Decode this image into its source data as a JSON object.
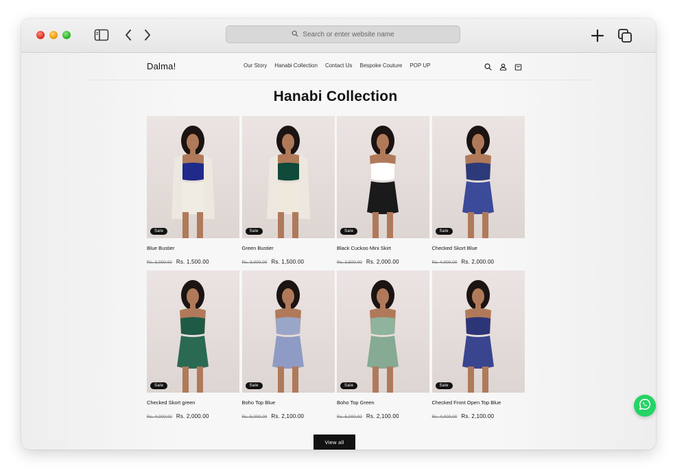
{
  "browser": {
    "address_placeholder": "Search or enter website name",
    "icons": [
      "sidebar-icon",
      "back-icon",
      "forward-icon",
      "plus-icon",
      "tabs-icon",
      "search-icon"
    ]
  },
  "header": {
    "brand": "Dalma!",
    "nav": [
      "Our Story",
      "Hanabi Collection",
      "Contact Us",
      "Bespoke Couture",
      "POP UP"
    ],
    "icons": [
      "search-icon",
      "account-icon",
      "cart-icon"
    ]
  },
  "collection": {
    "title": "Hanabi Collection",
    "badge": "Sale",
    "products": [
      {
        "name": "Blue Bustier",
        "old_price": "Rs. 3,000.00",
        "price": "Rs. 1,500.00",
        "top_color": "#1f2a8a",
        "bottom_color": "#f1ece3",
        "jacket": true
      },
      {
        "name": "Green Bustier",
        "old_price": "Rs. 3,000.00",
        "price": "Rs. 1,500.00",
        "top_color": "#0f4a3a",
        "bottom_color": "#efe8dc",
        "jacket": true
      },
      {
        "name": "Black Cuckoo Mini Skirt",
        "old_price": "Rs. 3,500.00",
        "price": "Rs. 2,000.00",
        "top_color": "#ffffff",
        "bottom_color": "#1a1a1a",
        "jacket": false
      },
      {
        "name": "Checked Skort Blue",
        "old_price": "Rs. 4,000.00",
        "price": "Rs. 2,000.00",
        "top_color": "#2d3a7a",
        "bottom_color": "#3c4a9a",
        "jacket": false
      },
      {
        "name": "Checked Skort green",
        "old_price": "Rs. 4,000.00",
        "price": "Rs. 2,000.00",
        "top_color": "#1f5a46",
        "bottom_color": "#2a6a52",
        "jacket": false
      },
      {
        "name": "Boho Top Blue",
        "old_price": "Rs. 5,000.00",
        "price": "Rs. 2,100.00",
        "top_color": "#9aa6c8",
        "bottom_color": "#8e9bc4",
        "jacket": false
      },
      {
        "name": "Boho Top Green",
        "old_price": "Rs. 5,000.00",
        "price": "Rs. 2,100.00",
        "top_color": "#8fb39c",
        "bottom_color": "#86aa94",
        "jacket": false
      },
      {
        "name": "Checked Front Open Top Blue",
        "old_price": "Rs. 4,000.00",
        "price": "Rs. 2,100.00",
        "top_color": "#2c3578",
        "bottom_color": "#3a4590",
        "jacket": false
      }
    ],
    "view_all": "View all"
  },
  "floating": {
    "icon": "whatsapp-icon",
    "color": "#25d366"
  },
  "colors": {
    "background": "#f7f7f7",
    "text": "#121212",
    "button": "#121212"
  }
}
